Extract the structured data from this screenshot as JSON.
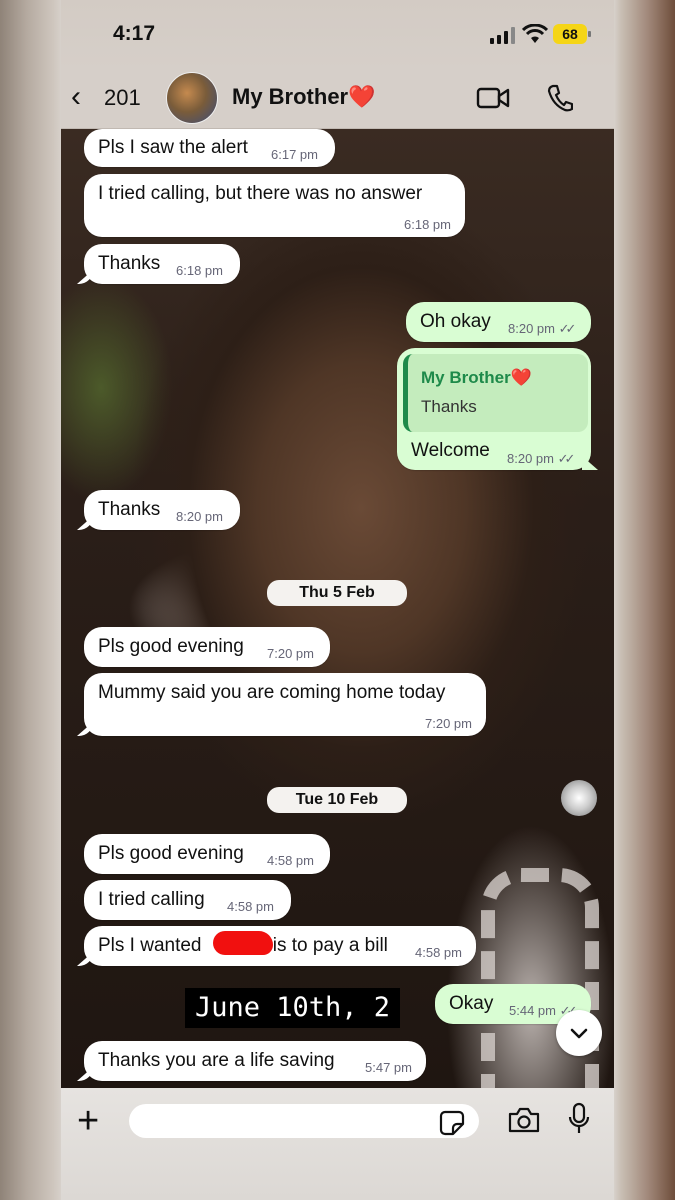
{
  "status_bar": {
    "time": "4:17",
    "battery": "68"
  },
  "header": {
    "back_count": "201",
    "contact_name": "My Brother❤️"
  },
  "messages": [
    {
      "text": "Pls I saw the alert",
      "time": "6:17 pm"
    },
    {
      "text": "I tried calling, but there was no answer",
      "time": "6:18 pm"
    },
    {
      "text": "Thanks",
      "time": "6:18 pm"
    },
    {
      "text": "Oh okay",
      "time": "8:20 pm"
    },
    {
      "quote_name": "My Brother❤️",
      "quote_text": "Thanks",
      "text": "Welcome",
      "time": "8:20 pm"
    },
    {
      "text": "Thanks",
      "time": "8:20 pm"
    },
    {
      "text": "Pls good evening",
      "time": "7:20 pm"
    },
    {
      "text": "Mummy said you are coming home today",
      "time": "7:20 pm"
    },
    {
      "text": "Pls good evening",
      "time": "4:58 pm"
    },
    {
      "text": "I tried calling",
      "time": "4:58 pm"
    },
    {
      "text_before": "Pls I wanted ",
      "text_after": "is to pay a bill",
      "time": "4:58 pm"
    },
    {
      "text": "Okay",
      "time": "5:44 pm"
    },
    {
      "text": "Thanks you are a life saving",
      "time": "5:47 pm"
    }
  ],
  "dates": [
    "Thu 5 Feb",
    "Tue 10 Feb"
  ],
  "wallpaper_caption": "June 10th, 2",
  "composer": {
    "placeholder": ""
  },
  "colors": {
    "incoming": "#ffffff",
    "outgoing": "#d9fdd3",
    "quote_name": "#1e8a4a"
  }
}
